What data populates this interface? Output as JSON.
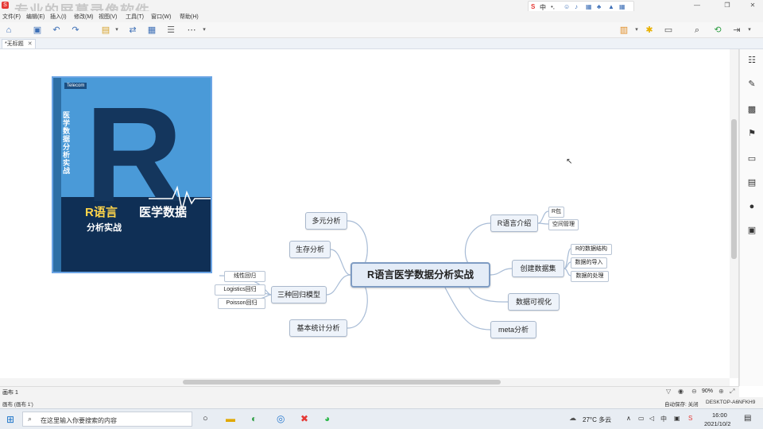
{
  "window": {
    "watermark": "专业的屏幕录像软件",
    "menu": [
      "文件(F)",
      "编辑(E)",
      "插入(I)",
      "修改(M)",
      "视图(V)",
      "工具(T)",
      "窗口(W)",
      "帮助(H)"
    ],
    "ime": {
      "label": "中"
    }
  },
  "tabs": {
    "active": "*无标题"
  },
  "mindmap": {
    "root": "R语言医学数据分析实战",
    "left": [
      {
        "label": "多元分析"
      },
      {
        "label": "生存分析"
      },
      {
        "label": "三种回归模型",
        "children": [
          "线性回归",
          "Logistics回归",
          "Poisson回归"
        ]
      },
      {
        "label": "基本统计分析"
      }
    ],
    "right": [
      {
        "label": "R语言介绍",
        "children": [
          "R包",
          "空间管理"
        ]
      },
      {
        "label": "创建数据集",
        "children": [
          "R的数据结构",
          "数据的导入",
          "数据的处理"
        ]
      },
      {
        "label": "数据可视化"
      },
      {
        "label": "meta分析"
      }
    ]
  },
  "book": {
    "publisher_logo": "Telecom",
    "vertical_title": "医学数据分析实战",
    "cover_r": "R",
    "cover_main_yellow": "R语言",
    "cover_main_white": "医学数据",
    "cover_sub": "分析实战"
  },
  "sheet": {
    "name": "画布 1"
  },
  "status": {
    "left": "画布 (画布 1')",
    "autosave": "自动保存: 关闭",
    "computer": "DESKTOP-A6NFKH9",
    "zoom": "90%"
  },
  "taskbar": {
    "search_placeholder": "在这里输入你要搜索的内容",
    "weather": "27°C 多云",
    "time": "16:00",
    "date": "2021/10/2"
  },
  "colors": {
    "accent": "#3d6fb6",
    "node_border": "#a9b8cc",
    "root_border": "#7f9cc3",
    "line": "#a8bcd6"
  }
}
